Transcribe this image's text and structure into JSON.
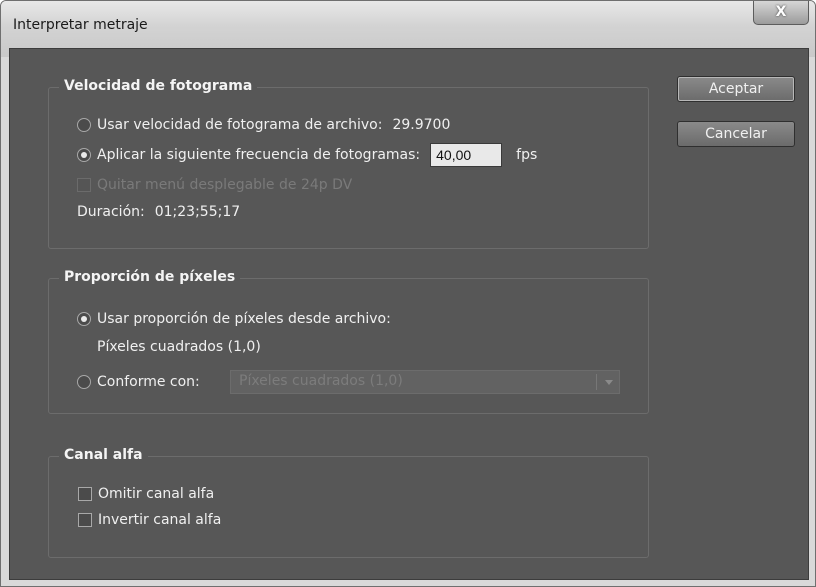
{
  "window": {
    "title": "Interpretar metraje",
    "close_label": "X"
  },
  "frame_rate": {
    "title": "Velocidad de fotograma",
    "use_file_label": "Usar velocidad de fotograma de archivo:",
    "file_value": "29.9700",
    "assume_label": "Aplicar la siguiente frecuencia de fotogramas:",
    "fps_value": "40,00",
    "fps_unit": "fps",
    "remove_pulldown_label": "Quitar menú desplegable de 24p DV",
    "duration_label": "Duración:",
    "duration_value": "01;23;55;17",
    "selected": "assume"
  },
  "pixel_aspect": {
    "title": "Proporción de píxeles",
    "use_file_label": "Usar proporción de píxeles desde archivo:",
    "file_value": "Píxeles cuadrados (1,0)",
    "conform_label": "Conforme con:",
    "conform_option": "Píxeles cuadrados (1,0)",
    "selected": "use_file"
  },
  "alpha": {
    "title": "Canal alfa",
    "ignore_label": "Omitir canal alfa",
    "invert_label": "Invertir canal alfa",
    "ignore_checked": false,
    "invert_checked": false
  },
  "buttons": {
    "ok_label": "Aceptar",
    "cancel_label": "Cancelar"
  }
}
